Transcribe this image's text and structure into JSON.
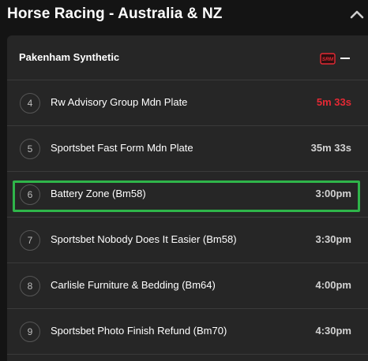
{
  "section": {
    "title": "Horse Racing - Australia & NZ"
  },
  "venue": {
    "name": "Pakenham Synthetic",
    "badge": "SRM"
  },
  "races": [
    {
      "number": "4",
      "name": "Rw Advisory Group Mdn Plate",
      "time": "5m 33s",
      "urgent": true,
      "selected": false
    },
    {
      "number": "5",
      "name": "Sportsbet Fast Form Mdn Plate",
      "time": "35m 33s",
      "urgent": false,
      "selected": false
    },
    {
      "number": "6",
      "name": "Battery Zone (Bm58)",
      "time": "3:00pm",
      "urgent": false,
      "selected": true
    },
    {
      "number": "7",
      "name": "Sportsbet Nobody Does It Easier (Bm58)",
      "time": "3:30pm",
      "urgent": false,
      "selected": false
    },
    {
      "number": "8",
      "name": "Carlisle Furniture & Bedding (Bm64)",
      "time": "4:00pm",
      "urgent": false,
      "selected": false
    },
    {
      "number": "9",
      "name": "Sportsbet Photo Finish Refund (Bm70)",
      "time": "4:30pm",
      "urgent": false,
      "selected": false
    }
  ],
  "colors": {
    "background": "#141414",
    "panel": "#262626",
    "urgent_time": "#e52934",
    "selected_border": "#2fb54a"
  },
  "icons": {
    "collapse": "chevron-up-icon",
    "venue_badge": "srm-badge-icon",
    "venue_collapse": "minus-icon"
  }
}
